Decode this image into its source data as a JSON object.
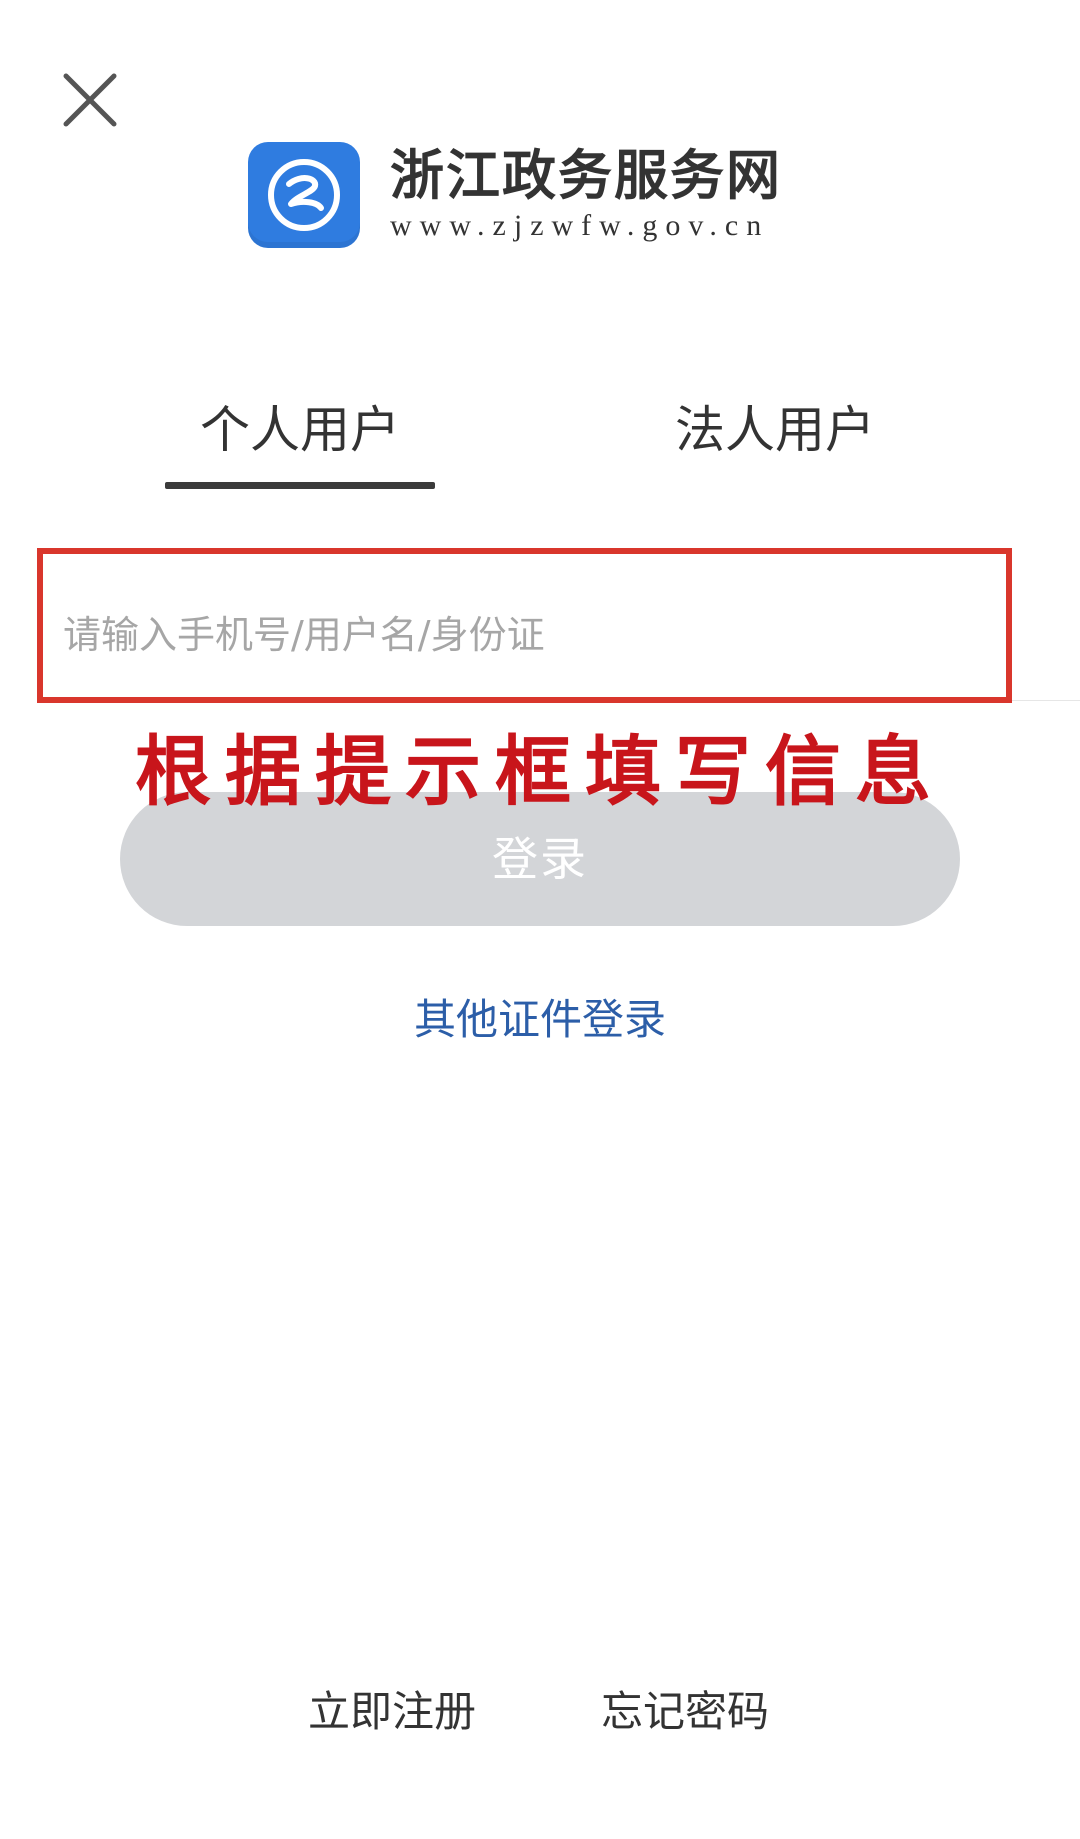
{
  "header": {
    "close_icon": "close-icon"
  },
  "brand": {
    "logo_icon": "zhejiang-gov-logo-icon",
    "logo_color": "#2f7ce0",
    "name": "浙江政务服务网",
    "url": "www.zjzwfw.gov.cn"
  },
  "tabs": [
    {
      "label": "个人用户",
      "active": true
    },
    {
      "label": "法人用户",
      "active": false
    }
  ],
  "account": {
    "value": "",
    "placeholder": "请输入手机号/用户名/身份证",
    "highlight_color": "#d9362c"
  },
  "annotation": {
    "text": "根据提示框填写信息",
    "color": "#c8151b"
  },
  "login_button": {
    "label": "登录",
    "enabled": false
  },
  "other_login": {
    "label": "其他证件登录",
    "color": "#2c5ea8"
  },
  "footer": {
    "register": "立即注册",
    "forgot": "忘记密码"
  }
}
